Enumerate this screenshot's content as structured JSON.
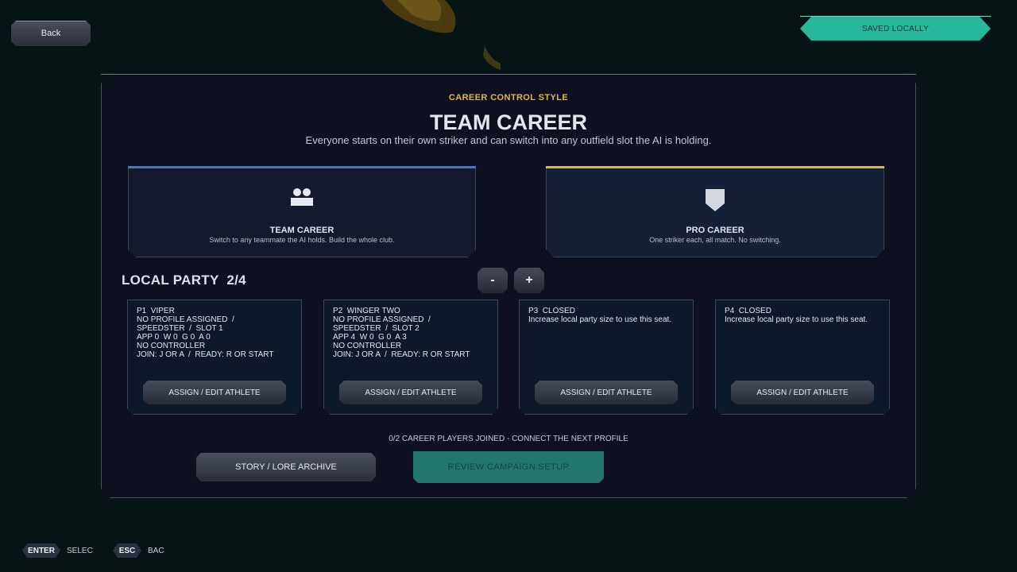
{
  "header": {
    "back_label": "Back",
    "saved_label": "SAVED LOCALLY"
  },
  "hero": {
    "eyebrow": "CAREER CONTROL STYLE",
    "title": "TEAM CAREER",
    "description": "Everyone starts on their own striker and can switch into any outfield slot the AI is holding."
  },
  "modes": [
    {
      "name": "TEAM CAREER",
      "subtitle": "Switch to any teammate the AI holds. Build the whole club.",
      "icon": "team-icon",
      "accent": "#3f74d8",
      "selected": true
    },
    {
      "name": "PRO CAREER",
      "subtitle": "One striker each, all match. No switching.",
      "icon": "shield-icon",
      "accent": "#e0b93a",
      "selected": false
    }
  ],
  "party": {
    "label": "LOCAL PARTY  2/4",
    "decrement_label": "-",
    "increment_label": "+",
    "seats": [
      {
        "lines": "P1  VIPER\nNO PROFILE ASSIGNED  /\nSPEEDSTER  /  SLOT 1\nAPP 0  W 0  G 0  A 0\nNO CONTROLLER\nJOIN: J OR A  /  READY: R OR START",
        "button": "ASSIGN / EDIT ATHLETE"
      },
      {
        "lines": "P2  WINGER TWO\nNO PROFILE ASSIGNED  /\nSPEEDSTER  /  SLOT 2\nAPP 4  W 0  G 0  A 3\nNO CONTROLLER\nJOIN: J OR A  /  READY: R OR START",
        "button": "ASSIGN / EDIT ATHLETE"
      },
      {
        "lines": "P3  CLOSED\nIncrease local party size to use this seat.",
        "button": "ASSIGN / EDIT ATHLETE"
      },
      {
        "lines": "P4  CLOSED\nIncrease local party size to use this seat.",
        "button": "ASSIGN / EDIT ATHLETE"
      }
    ]
  },
  "footer": {
    "status": "0/2 CAREER PLAYERS JOINED - CONNECT THE NEXT PROFILE",
    "lore_label": "STORY / LORE ARCHIVE",
    "review_label": "REVIEW CAMPAIGN SETUP"
  },
  "hints": [
    {
      "key": "ENTER",
      "action": "SELEC"
    },
    {
      "key": "ESC",
      "action": "BAC"
    }
  ],
  "colors": {
    "accent_teal": "#27b79b",
    "accent_blue": "#3f74d8",
    "accent_gold": "#e0b93a"
  }
}
